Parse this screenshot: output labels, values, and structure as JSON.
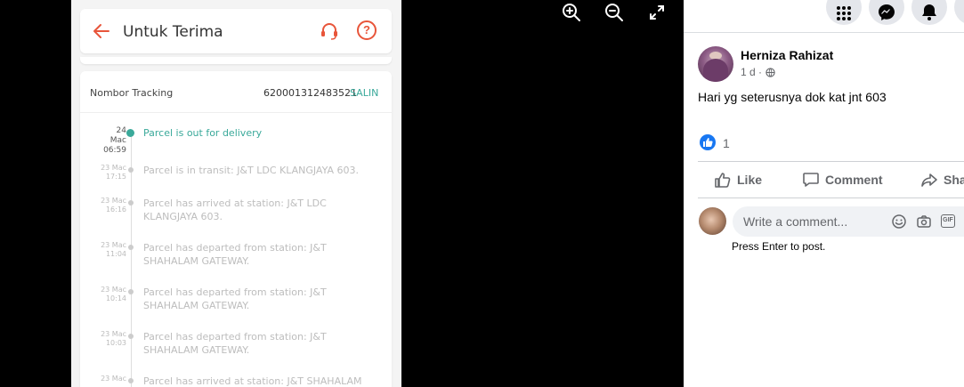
{
  "photo": {
    "app_title": "Untuk Terima",
    "tracking_label": "Nombor Tracking",
    "tracking_number": "620001312483521",
    "copy_label": "SALIN",
    "events": [
      {
        "date": "24\nMac\n06:59",
        "text": "Parcel is out for delivery",
        "active": true
      },
      {
        "date": "23 Mac\n17:15",
        "text": "Parcel is in transit: J&T LDC KLANGJAYA 603."
      },
      {
        "date": "23 Mac\n16:16",
        "text": "Parcel has arrived at station: J&T LDC KLANGJAYA 603."
      },
      {
        "date": "23 Mac\n11:04",
        "text": "Parcel has departed from station: J&T SHAHALAM GATEWAY."
      },
      {
        "date": "23 Mac\n10:14",
        "text": "Parcel has departed from station: J&T SHAHALAM GATEWAY."
      },
      {
        "date": "23 Mac\n10:03",
        "text": "Parcel has departed from station: J&T SHAHALAM GATEWAY."
      },
      {
        "date": "23 Mac",
        "text": "Parcel has arrived at station: J&T SHAHALAM"
      }
    ]
  },
  "viewer": {
    "zoom_in_icon": "zoom-in-icon",
    "zoom_out_icon": "zoom-out-icon",
    "fullscreen_icon": "expand-icon"
  },
  "post": {
    "author": "Herniza Rahizat",
    "time": "1 d ·",
    "text": "Hari yg seterusnya dok kat jnt 603",
    "like_count": "1",
    "actions": {
      "like": "Like",
      "comment": "Comment",
      "share": "Share"
    },
    "comment_placeholder": "Write a comment...",
    "comment_hint": "Press Enter to post.",
    "gif_label": "GIF"
  },
  "colors": {
    "accent": "#1877f2",
    "jt_green": "#3aa99a",
    "jt_red": "#e8553a"
  }
}
